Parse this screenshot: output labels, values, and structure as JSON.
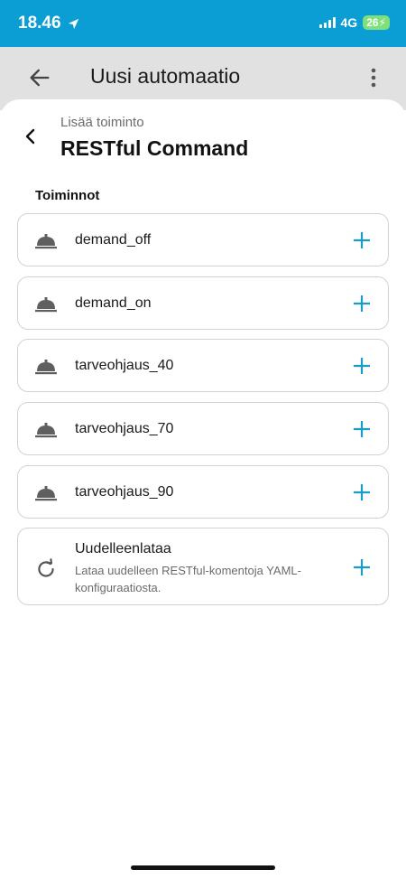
{
  "status_bar": {
    "time": "18.46",
    "network": "4G",
    "battery": "26"
  },
  "app_bar": {
    "title": "Uusi automaatio"
  },
  "sheet": {
    "subtitle": "Lisää toiminto",
    "title": "RESTful Command",
    "section_label": "Toiminnot",
    "items": [
      {
        "label": "demand_off",
        "icon": "bell-icon"
      },
      {
        "label": "demand_on",
        "icon": "bell-icon"
      },
      {
        "label": "tarveohjaus_40",
        "icon": "bell-icon"
      },
      {
        "label": "tarveohjaus_70",
        "icon": "bell-icon"
      },
      {
        "label": "tarveohjaus_90",
        "icon": "bell-icon"
      },
      {
        "label": "Uudelleenlataa",
        "description": "Lataa uudelleen RESTful-komentoja YAML-konfiguraatiosta.",
        "icon": "reload-icon"
      }
    ]
  },
  "colors": {
    "accent": "#0a9ed4",
    "plus": "#1a9bc9",
    "status_bar": "#0a9ed4",
    "app_bar": "#e1e1e1"
  }
}
